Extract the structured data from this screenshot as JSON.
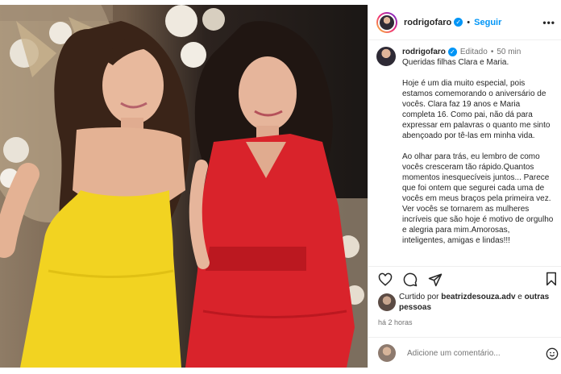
{
  "header": {
    "username": "rodrigofaro",
    "verified_icon": "verified-badge-icon",
    "separator": "•",
    "follow_label": "Seguir",
    "more_icon": "more-options-icon"
  },
  "caption": {
    "username": "rodrigofaro",
    "separator": "•",
    "edited_label": "Editado",
    "time_ago": "50 min",
    "greeting": "Queridas filhas Clara e Maria.",
    "paragraph1": "Hoje é um dia muito especial, pois estamos comemorando o aniversário de vocês. Clara faz 19 anos e Maria completa 16. Como pai, não dá para expressar em palavras o quanto me sinto abençoado por tê-las em minha vida.",
    "paragraph2": "Ao olhar para trás, eu lembro de como vocês cresceram tão rápido.Quantos momentos inesquecíveis juntos... Parece que foi ontem que segurei cada uma de vocês em meus braços pela primeira vez. Ver vocês se tornarem as mulheres incríveis que são hoje é motivo de orgulho e alegria para mim.Amorosas, inteligentes, amigas e lindas!!!"
  },
  "actions": {
    "like_icon": "heart-icon",
    "comment_icon": "comment-icon",
    "share_icon": "share-icon",
    "save_icon": "bookmark-icon"
  },
  "likes": {
    "prefix": "Curtido por",
    "user": "beatrizdesouza.adv",
    "connector": "e",
    "others": "outras pessoas"
  },
  "timestamp": "há 2 horas",
  "comment": {
    "placeholder": "Adicione um comentário...",
    "emoji_icon": "emoji-icon"
  },
  "colors": {
    "accent": "#0095f6",
    "verified": "#0095f6",
    "text": "#262626",
    "muted": "#737373",
    "yellow_dress": "#f2d321",
    "red_dress": "#d9232b"
  }
}
